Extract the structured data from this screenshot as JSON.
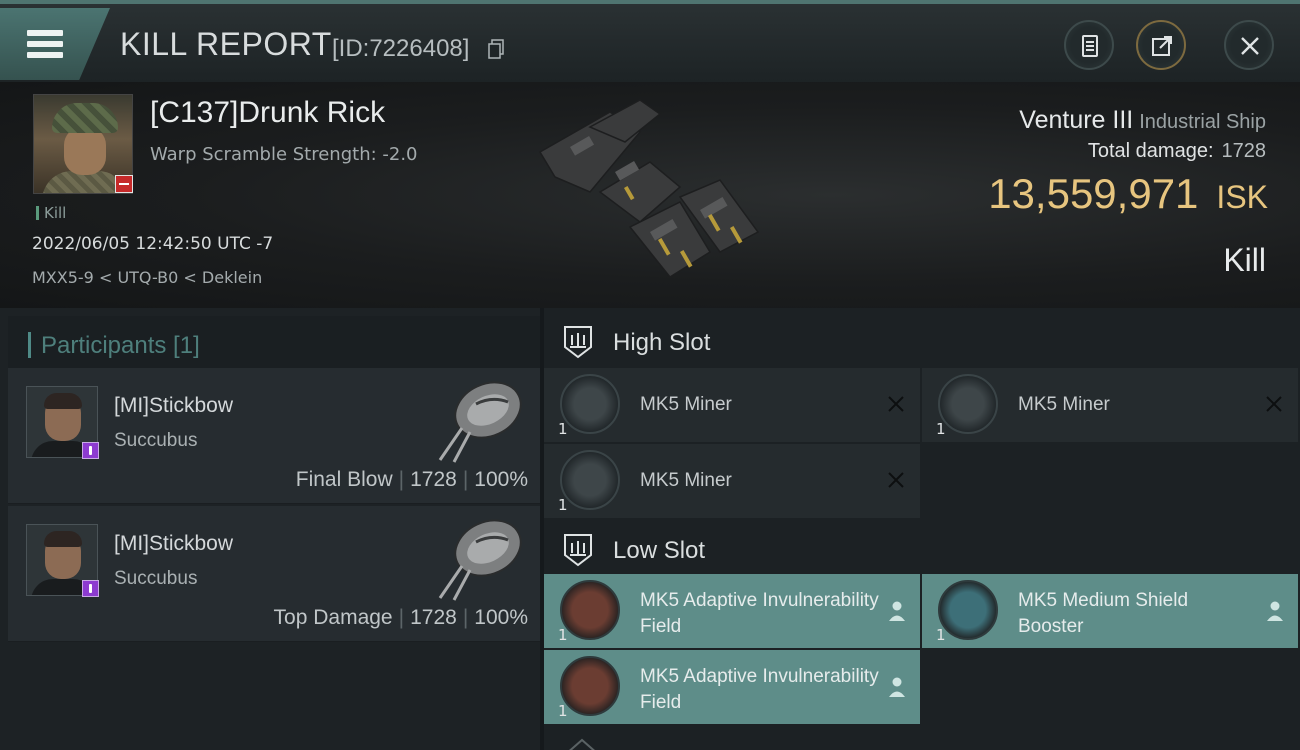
{
  "header": {
    "title": "KILL REPORT",
    "report_id": "[ID:7226408]",
    "icons": [
      "menu-icon",
      "copy-icon",
      "clipboard-icon",
      "share-icon",
      "close-icon"
    ],
    "accent_color": "#4f7470"
  },
  "victim": {
    "name": "[C137]Drunk Rick",
    "warp_scramble": "Warp Scramble Strength: -2.0",
    "tag": "Kill",
    "datetime": "2022/06/05 12:42:50 UTC -7",
    "location": "MXX5-9 < UTQ-B0 < Deklein"
  },
  "ship": {
    "name": "Venture III",
    "class": "Industrial Ship",
    "total_damage_label": "Total damage:",
    "total_damage_value": "1728",
    "isk_amount": "13,559,971",
    "isk_currency": "ISK",
    "result": "Kill",
    "isk_color": "#e7c57f"
  },
  "participants": {
    "heading": "Participants [1]",
    "items": [
      {
        "name": "[MI]Stickbow",
        "ship": "Succubus",
        "role": "Final Blow",
        "damage": "1728",
        "percent": "100%"
      },
      {
        "name": "[MI]Stickbow",
        "ship": "Succubus",
        "role": "Top Damage",
        "damage": "1728",
        "percent": "100%"
      }
    ]
  },
  "slots": {
    "high": {
      "label": "High Slot",
      "modules": [
        {
          "name": "MK5 Miner",
          "qty": "1",
          "status": "destroyed"
        },
        {
          "name": "MK5 Miner",
          "qty": "1",
          "status": "destroyed"
        },
        {
          "name": "MK5 Miner",
          "qty": "1",
          "status": "destroyed"
        }
      ]
    },
    "low": {
      "label": "Low Slot",
      "modules": [
        {
          "name": "MK5 Adaptive Invulnerability Field",
          "qty": "1",
          "status": "dropped"
        },
        {
          "name": "MK5 Medium Shield Booster",
          "qty": "1",
          "status": "dropped"
        },
        {
          "name": "MK5 Adaptive Invulnerability Field",
          "qty": "1",
          "status": "dropped"
        }
      ]
    },
    "dropped_color": "#5e8d89"
  }
}
